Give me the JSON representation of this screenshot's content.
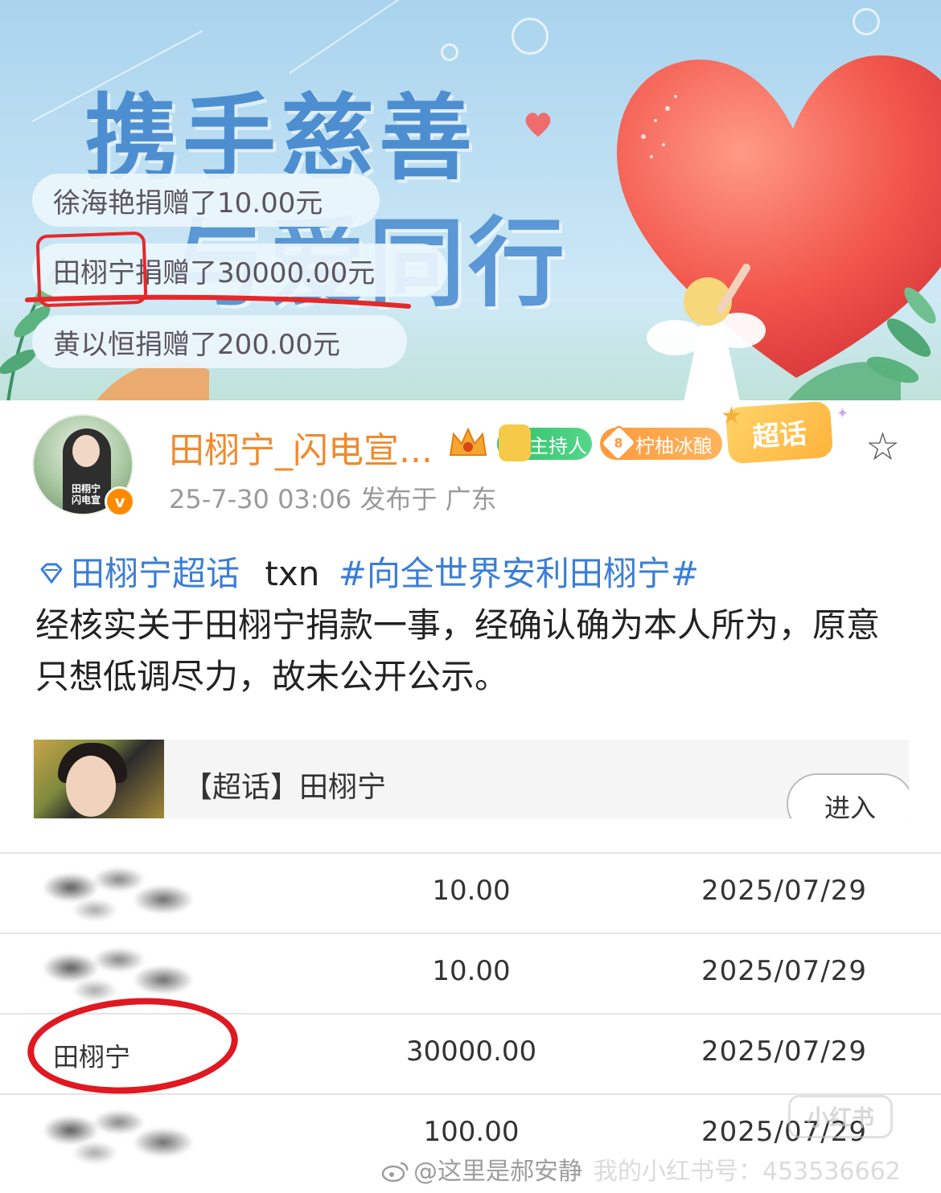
{
  "banner": {
    "title_line1": "携手慈善",
    "title_line2": "与爱同行",
    "donations": [
      {
        "name": "徐海艳",
        "text": "捐赠了10.00元"
      },
      {
        "name": "田栩宁",
        "text": "捐赠了30000.00元"
      },
      {
        "name": "黄以恒",
        "text": "捐赠了200.00元"
      }
    ]
  },
  "post": {
    "username": "田栩宁_闪电宣...",
    "badges": {
      "host": "主持人",
      "fan_level": "8",
      "fan": "柠柚冰酿",
      "super": "超话"
    },
    "avatar_tag": "田栩宁 闪电宣",
    "meta": "25-7-30 03:06  发布于 广东",
    "topic": "田栩宁超话",
    "topic_sep": "txn",
    "hashtag": "#向全世界安利田栩宁#",
    "text": "经核实关于田栩宁捐款一事，经确认确为本人所为，原意只想低调尽力，故未公开公示。",
    "card": {
      "title": "【超话】田栩宁",
      "enter": "进入"
    }
  },
  "table": {
    "rows": [
      {
        "name": "",
        "amount": "10.00",
        "date": "2025/07/29"
      },
      {
        "name": "",
        "amount": "10.00",
        "date": "2025/07/29"
      },
      {
        "name": "田栩宁",
        "amount": "30000.00",
        "date": "2025/07/29"
      },
      {
        "name": "",
        "amount": "100.00",
        "date": "2025/07/29"
      }
    ]
  },
  "watermarks": {
    "logo": "小红书",
    "weibo": "@这里是郝安静",
    "xhs": "我的小红书号：453536662"
  },
  "colors": {
    "accent_orange": "#f08a2c",
    "link_blue": "#3b7ed6",
    "annotation_red": "#e01822"
  }
}
